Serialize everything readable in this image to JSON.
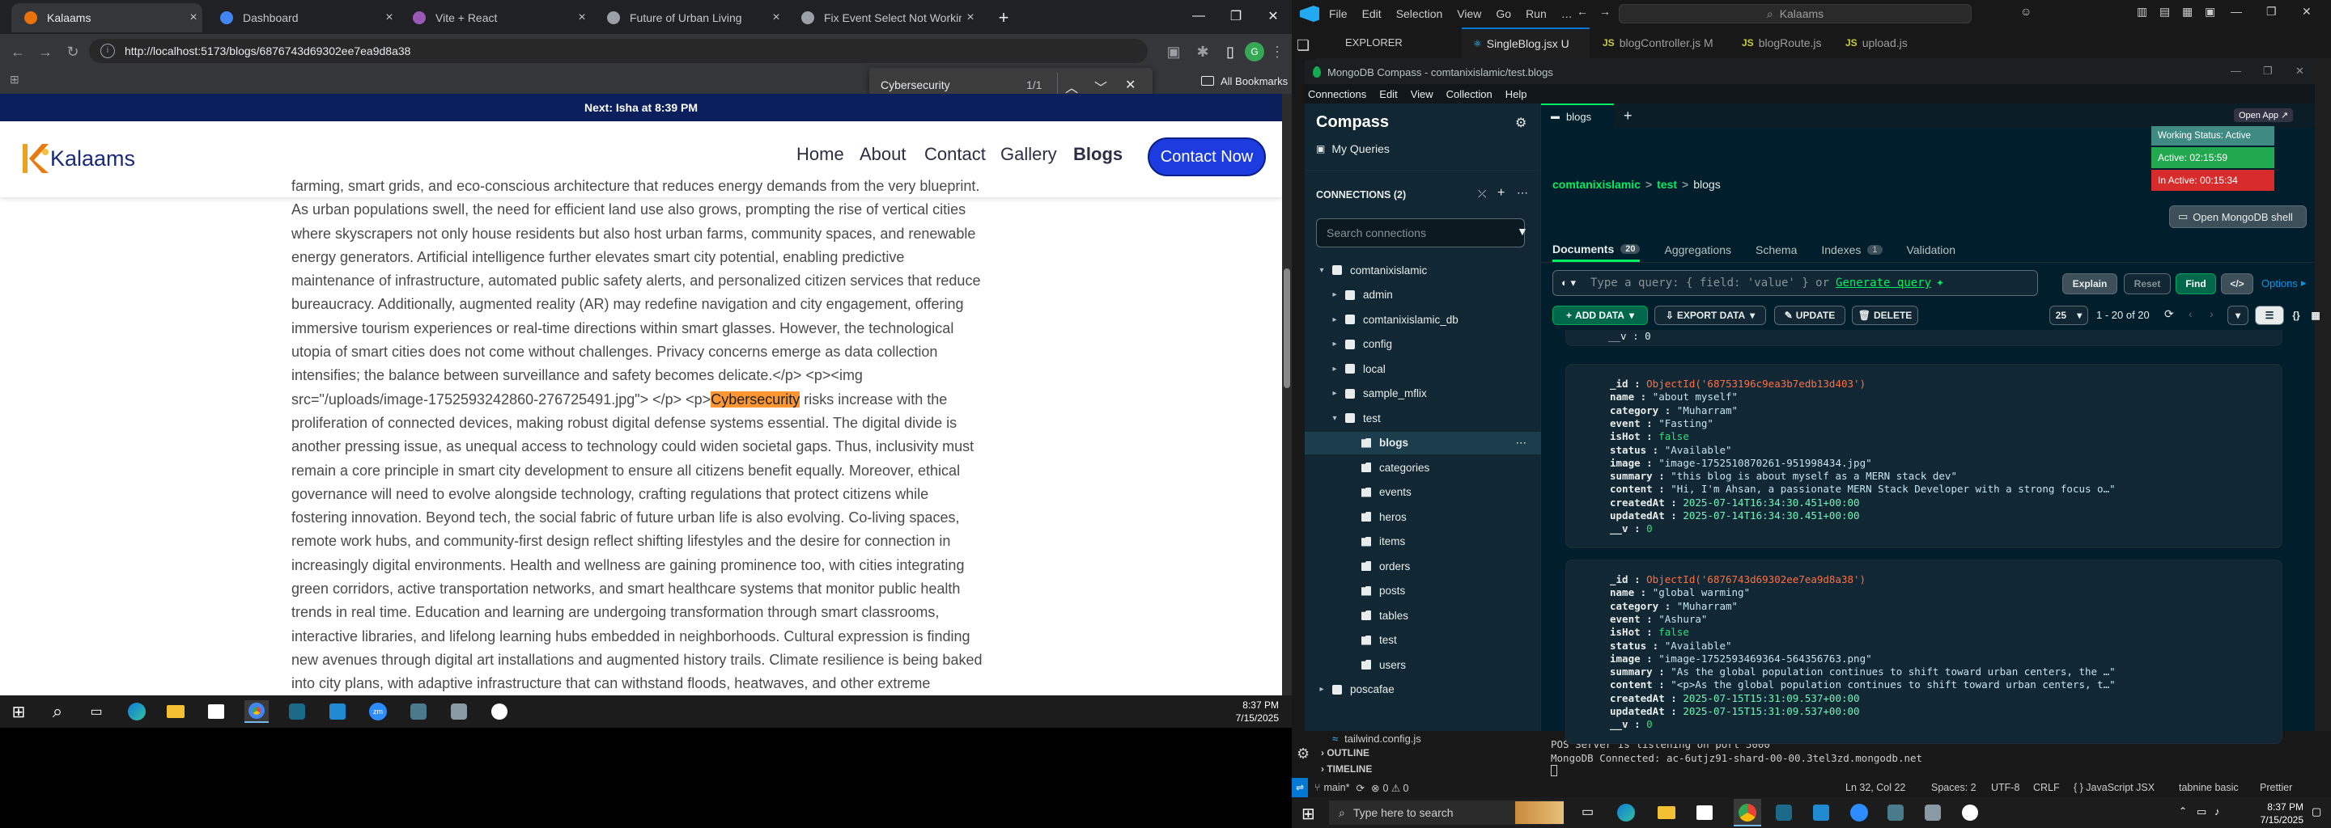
{
  "chrome": {
    "tabs": [
      {
        "label": "Kalaams",
        "active": true,
        "color": "#e8710a"
      },
      {
        "label": "Dashboard",
        "active": false,
        "color": "#4285f4"
      },
      {
        "label": "Vite + React",
        "active": false,
        "color": "#9b59b6"
      },
      {
        "label": "Future of Urban Living",
        "active": false,
        "color": "#9aa0a6"
      },
      {
        "label": "Fix Event Select Not Working in",
        "active": false,
        "color": "#9aa0a6"
      }
    ],
    "url": "http://localhost:5173/blogs/6876743d69302ee7ea9d8a38",
    "all_bookmarks": "All Bookmarks",
    "find": {
      "query": "Cybersecurity",
      "count": "1/1"
    }
  },
  "site": {
    "banner": "Next: Isha at 8:39 PM",
    "logo": "Kalaams",
    "nav": [
      "Home",
      "About",
      "Contact",
      "Gallery",
      "Blogs"
    ],
    "cta": "Contact Now",
    "article_before": "farming, smart grids, and eco-conscious architecture that reduces energy demands from the very blueprint. As urban populations swell, the need for efficient land use also grows, prompting the rise of vertical cities where skyscrapers not only house residents but also host urban farms, community spaces, and renewable energy generators. Artificial intelligence further elevates smart city potential, enabling predictive maintenance of infrastructure, automated public safety alerts, and personalized citizen services that reduce bureaucracy. Additionally, augmented reality (AR) may redefine navigation and city engagement, offering immersive tourism experiences or real-time directions within smart glasses. However, the technological utopia of smart cities does not come without challenges. Privacy concerns emerge as data collection intensifies; the balance between surveillance and safety becomes delicate.</p> <p><img src=\"/uploads/image-1752593242860-276725491.jpg\"> </p> <p>",
    "highlight": "Cybersecurity",
    "article_after": " risks increase with the proliferation of connected devices, making robust digital defense systems essential. The digital divide is another pressing issue, as unequal access to technology could widen societal gaps. Thus, inclusivity must remain a core principle in smart city development to ensure all citizens benefit equally. Moreover, ethical governance will need to evolve alongside technology, crafting regulations that protect citizens while fostering innovation. Beyond tech, the social fabric of future urban life is also evolving. Co-living spaces, remote work hubs, and community-first design reflect shifting lifestyles and the desire for connection in increasingly digital environments. Health and wellness are gaining prominence too, with cities integrating green corridors, active transportation networks, and smart healthcare systems that monitor public health trends in real time. Education and learning are undergoing transformation through smart classrooms, interactive libraries, and lifelong learning hubs embedded in neighborhoods. Cultural expression is finding new avenues through digital art installations and augmented history trails. Climate resilience is being baked into city plans, with adaptive infrastructure that can withstand floods, heatwaves, and other extreme"
  },
  "left_taskbar": {
    "time": "8:37 PM",
    "date": "7/15/2025"
  },
  "vscode": {
    "menu": [
      "File",
      "Edit",
      "Selection",
      "View",
      "Go",
      "Run"
    ],
    "search": "Kalaams",
    "explorer": "EXPLORER",
    "tabs": [
      {
        "label": "SingleBlog.jsx U",
        "active": true,
        "color": "#4fc1ff"
      },
      {
        "label": "blogController.js M",
        "active": false,
        "color": "#cbcb41"
      },
      {
        "label": "blogRoute.js",
        "active": false,
        "color": "#cbcb41"
      },
      {
        "label": "upload.js",
        "active": false,
        "color": "#cbcb41"
      }
    ],
    "file_bottom": "tailwind.config.js",
    "outline": "OUTLINE",
    "timeline": "TIMELINE",
    "terminal": [
      "POS Server is listening on port 5000",
      "MongoDB Connected: ac-6utjz91-shard-00-00.3tel3zd.mongodb.net"
    ],
    "status_left": "main*",
    "status_errors": "0 ⚠ 0",
    "status_right": [
      "Ln 32, Col 22",
      "Spaces: 2",
      "UTF-8",
      "CRLF",
      "{ } JavaScript JSX",
      "tabnine basic",
      "Prettier"
    ]
  },
  "compass": {
    "title": "MongoDB Compass - comtanixislamic/test.blogs",
    "menu": [
      "Connections",
      "Edit",
      "View",
      "Collection",
      "Help"
    ],
    "open_app": "Open App ↗",
    "status_working": "Working Status: Active",
    "status_active": "Active: 02:15:59",
    "status_inactive": "In Active: 00:15:34",
    "brand": "Compass",
    "my_queries": "My Queries",
    "connections_label": "CONNECTIONS (2)",
    "search_placeholder": "Search connections",
    "tree": [
      {
        "label": "comtanixislamic",
        "level": 0,
        "kind": "conn",
        "open": true
      },
      {
        "label": "admin",
        "level": 1,
        "kind": "db"
      },
      {
        "label": "comtanixislamic_db",
        "level": 1,
        "kind": "db"
      },
      {
        "label": "config",
        "level": 1,
        "kind": "db"
      },
      {
        "label": "local",
        "level": 1,
        "kind": "db"
      },
      {
        "label": "sample_mflix",
        "level": 1,
        "kind": "db"
      },
      {
        "label": "test",
        "level": 1,
        "kind": "db",
        "open": true
      },
      {
        "label": "blogs",
        "level": 2,
        "kind": "coll",
        "selected": true
      },
      {
        "label": "categories",
        "level": 2,
        "kind": "coll"
      },
      {
        "label": "events",
        "level": 2,
        "kind": "coll"
      },
      {
        "label": "heros",
        "level": 2,
        "kind": "coll"
      },
      {
        "label": "items",
        "level": 2,
        "kind": "coll"
      },
      {
        "label": "orders",
        "level": 2,
        "kind": "coll"
      },
      {
        "label": "posts",
        "level": 2,
        "kind": "coll"
      },
      {
        "label": "tables",
        "level": 2,
        "kind": "coll"
      },
      {
        "label": "test",
        "level": 2,
        "kind": "coll"
      },
      {
        "label": "users",
        "level": 2,
        "kind": "coll"
      },
      {
        "label": "poscafae",
        "level": 0,
        "kind": "conn"
      }
    ],
    "tab": "blogs",
    "crumbs": [
      "comtanixislamic",
      ">",
      "test",
      ">",
      "blogs"
    ],
    "open_shell": "Open MongoDB shell",
    "subtabs": [
      {
        "label": "Documents",
        "count": "20"
      },
      {
        "label": "Aggregations"
      },
      {
        "label": "Schema"
      },
      {
        "label": "Indexes",
        "count": "1"
      },
      {
        "label": "Validation"
      }
    ],
    "query_placeholder": "Type a query: { field: 'value' } or",
    "generate_query": "Generate query",
    "btn_explain": "Explain",
    "btn_reset": "Reset",
    "btn_find": "Find",
    "btn_options": "Options",
    "btn_add": "ADD DATA",
    "btn_export": "EXPORT DATA",
    "btn_update": "UPDATE",
    "btn_delete": "DELETE",
    "page_size": "25",
    "page_range": "1 - 20 of 20",
    "top_partial": "__v : 0",
    "docs": [
      {
        "_id": "ObjectId('68753196c9ea3b7edb13d403')",
        "name": "\"about myself\"",
        "category": "\"Muharram\"",
        "event": "\"Fasting\"",
        "isHot": "false",
        "status": "\"Available\"",
        "image": "\"image-1752510870261-951998434.jpg\"",
        "summary": "\"this blog is about myself as a MERN stack dev\"",
        "content": "\"Hi, I'm Ahsan, a passionate MERN Stack Developer with a strong focus o…\"",
        "createdAt": "2025-07-14T16:34:30.451+00:00",
        "updatedAt": "2025-07-14T16:34:30.451+00:00",
        "v": "0"
      },
      {
        "_id": "ObjectId('6876743d69302ee7ea9d8a38')",
        "name": "\"global warming\"",
        "category": "\"Muharram\"",
        "event": "\"Ashura\"",
        "isHot": "false",
        "status": "\"Available\"",
        "image": "\"image-1752593469364-564356763.png\"",
        "summary": "\"As the global population continues to shift toward urban centers, the …\"",
        "content": "\"<p>As the global population continues to shift toward urban centers, t…\"",
        "createdAt": "2025-07-15T15:31:09.537+00:00",
        "updatedAt": "2025-07-15T15:31:09.537+00:00",
        "v": "0"
      }
    ]
  },
  "win_taskbar": {
    "search": "Type here to search",
    "time": "8:37 PM",
    "date": "7/15/2025"
  }
}
